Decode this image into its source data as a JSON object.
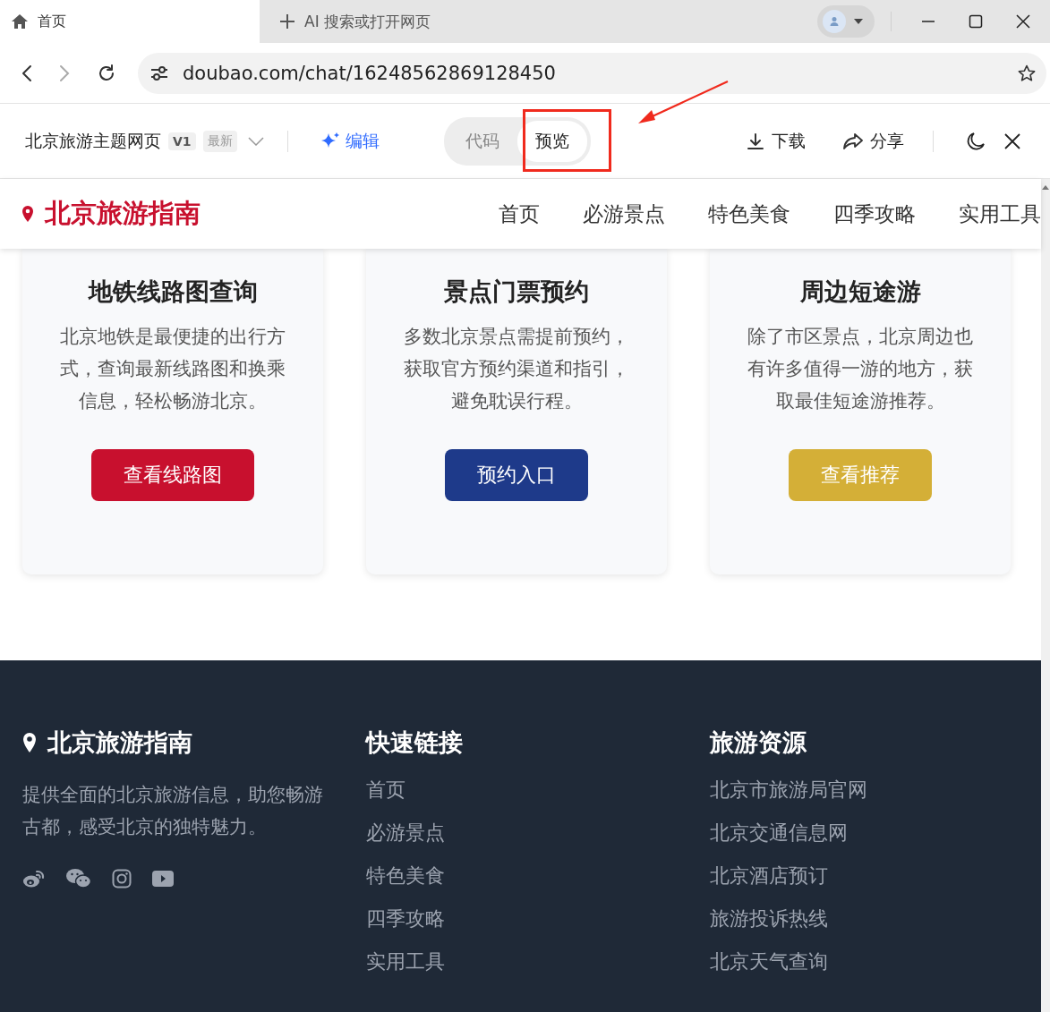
{
  "browser": {
    "tabs": [
      {
        "label": "首页",
        "selected": true,
        "kind": "home"
      },
      {
        "label": "AI 搜索或打开网页",
        "selected": false,
        "kind": "new"
      }
    ],
    "address": "doubao.com/chat/16248562869128450"
  },
  "toolbar": {
    "title": "北京旅游主题网页",
    "version": "V1",
    "badge": "最新",
    "edit": "编辑",
    "views": [
      {
        "label": "代码",
        "selected": false
      },
      {
        "label": "预览",
        "selected": true
      }
    ],
    "download": "下载",
    "share": "分享"
  },
  "site": {
    "brand": "北京旅游指南",
    "nav": [
      {
        "label": "首页"
      },
      {
        "label": "必游景点"
      },
      {
        "label": "特色美食"
      },
      {
        "label": "四季攻略"
      },
      {
        "label": "实用工具"
      }
    ],
    "cards": [
      {
        "title": "地铁线路图查询",
        "text": "北京地铁是最便捷的出行方式，查询最新线路图和换乘信息，轻松畅游北京。",
        "button": "查看线路图",
        "color": "#c8102e"
      },
      {
        "title": "景点门票预约",
        "text": "多数北京景点需提前预约，获取官方预约渠道和指引，避免耽误行程。",
        "button": "预约入口",
        "color": "#1e3a8a"
      },
      {
        "title": "周边短途游",
        "text": "除了市区景点，北京周边也有许多值得一游的地方，获取最佳短途游推荐。",
        "button": "查看推荐",
        "color": "#d4af37"
      }
    ],
    "footer": {
      "brand": "北京旅游指南",
      "about": "提供全面的北京旅游信息，助您畅游古都，感受北京的独特魅力。",
      "columns": [
        {
          "heading": "快速链接",
          "links": [
            "首页",
            "必游景点",
            "特色美食",
            "四季攻略",
            "实用工具"
          ]
        },
        {
          "heading": "旅游资源",
          "links": [
            "北京市旅游局官网",
            "北京交通信息网",
            "北京酒店预订",
            "旅游投诉热线",
            "北京天气查询"
          ]
        }
      ]
    }
  }
}
